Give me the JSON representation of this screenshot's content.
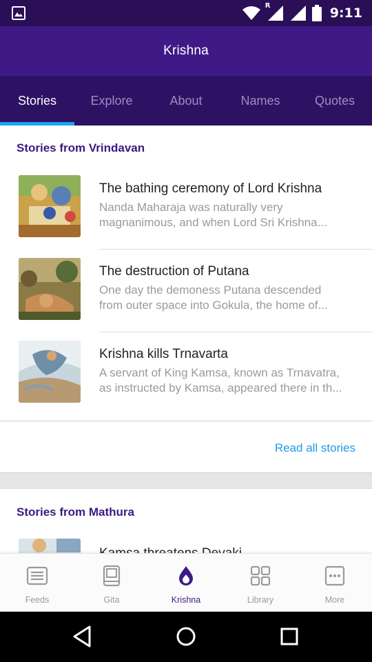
{
  "status_bar": {
    "time": "9:11",
    "network_badge": "R"
  },
  "app_bar": {
    "title": "Krishna"
  },
  "tabs": [
    {
      "label": "Stories",
      "active": true
    },
    {
      "label": "Explore",
      "active": false
    },
    {
      "label": "About",
      "active": false
    },
    {
      "label": "Names",
      "active": false
    },
    {
      "label": "Quotes",
      "active": false
    }
  ],
  "sections": [
    {
      "title": "Stories from Vrindavan",
      "stories": [
        {
          "title": "The bathing ceremony of Lord Krishna",
          "desc_line1": "Nanda Maharaja was naturally very",
          "desc_line2": "magnanimous, and when Lord Sri Krishna..."
        },
        {
          "title": "The destruction of Putana",
          "desc_line1": "One day the demoness Putana descended",
          "desc_line2": "from outer space into Gokula, the home of..."
        },
        {
          "title": "Krishna kills Trnavarta",
          "desc_line1": "A servant of King Kamsa, known as Trnavatra,",
          "desc_line2": "as instructed by Kamsa, appeared there in th..."
        }
      ],
      "read_all": "Read all stories"
    },
    {
      "title": "Stories from Mathura",
      "stories": [
        {
          "title": "Kamsa threatens Devaki"
        }
      ]
    }
  ],
  "bottom_nav": [
    {
      "label": "Feeds",
      "icon": "feeds-icon",
      "active": false
    },
    {
      "label": "Gita",
      "icon": "book-icon",
      "active": false
    },
    {
      "label": "Krishna",
      "icon": "flame-drop-icon",
      "active": true
    },
    {
      "label": "Library",
      "icon": "grid-icon",
      "active": false
    },
    {
      "label": "More",
      "icon": "more-dots-icon",
      "active": false
    }
  ],
  "colors": {
    "status_bar": "#2a0f57",
    "app_bar": "#3f1a87",
    "tab_bar": "#2d1264",
    "tab_indicator": "#1fa3ef",
    "section_title": "#3a1a80",
    "link": "#1e9be6"
  }
}
